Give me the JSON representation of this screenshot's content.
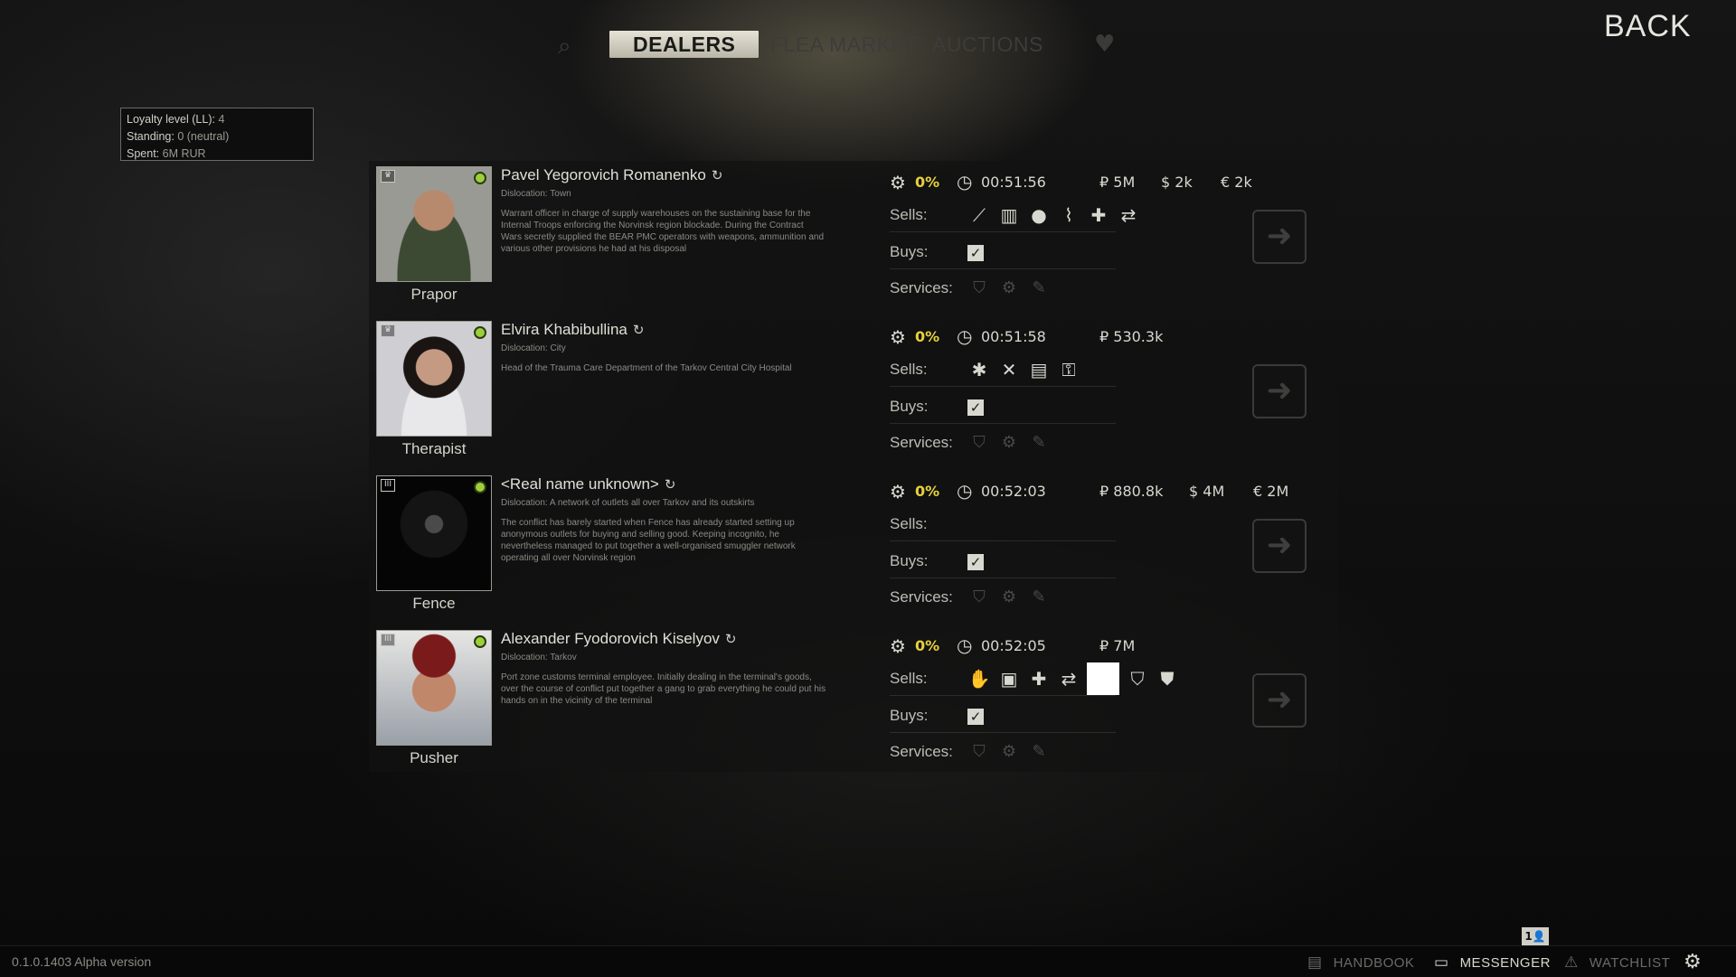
{
  "nav": {
    "tabs": [
      {
        "label": "DEALERS",
        "active": true
      },
      {
        "label": "FLEA MARKET",
        "active": false
      },
      {
        "label": "AUCTIONS",
        "active": false
      }
    ],
    "search_icon": "search-icon",
    "favorites_icon": "heart-icon",
    "back_label": "BACK"
  },
  "tooltip": {
    "loyalty_label": "Loyalty level (LL):",
    "loyalty_value": "4",
    "standing_label": "Standing:",
    "standing_value": "0 (neutral)",
    "spent_label": "Spent:",
    "spent_value": "6M RUR"
  },
  "labels": {
    "sells": "Sells:",
    "buys": "Buys:",
    "services": "Services:"
  },
  "dealers": [
    {
      "nickname": "Prapor",
      "full_name": "Pavel Yegorovich Romanenko",
      "dislocation": "Dislocation: Town",
      "description": "Warrant officer in charge of supply warehouses on the sustaining base for the Internal Troops enforcing the Norvinsk region blockade. During the Contract Wars secretly supplied the BEAR PMC operators with weapons, ammunition and various other provisions he had at his disposal",
      "rank": "♛",
      "discount": "0%",
      "timer": "00:51:56",
      "money": [
        "₽ 5M",
        "$ 2k",
        "€ 2k"
      ],
      "sells": [
        "rifle-icon",
        "magazine-icon",
        "grenade-icon",
        "knife-icon",
        "medkit-icon",
        "trade-icon"
      ],
      "buys_checked": true
    },
    {
      "nickname": "Therapist",
      "full_name": "Elvira Khabibullina",
      "dislocation": "Dislocation: City",
      "description": "Head of the Trauma Care Department of the Tarkov Central City Hospital",
      "rank": "♛",
      "discount": "0%",
      "timer": "00:51:58",
      "money": [
        "₽ 530.3k"
      ],
      "sells": [
        "meds-icon",
        "food-icon",
        "info-icon",
        "key-icon"
      ],
      "buys_checked": true
    },
    {
      "nickname": "Fence",
      "full_name": "<Real name unknown>",
      "dislocation": "Dislocation: A network of outlets all over Tarkov and its outskirts",
      "description": "The conflict has barely started when Fence has already started setting up anonymous outlets for buying and selling good. Keeping incognito, he nevertheless managed to put together a well-organised smuggler network operating all over Norvinsk region",
      "rank": "III",
      "discount": "0%",
      "timer": "00:52:03",
      "money": [
        "₽ 880.8k",
        "$ 4M",
        "€ 2M"
      ],
      "sells": [],
      "buys_checked": true
    },
    {
      "nickname": "Pusher",
      "full_name": "Alexander Fyodorovich Kiselyov",
      "dislocation": "Dislocation: Tarkov",
      "description": "Port zone customs terminal employee. Initially dealing in the terminal's goods, over the course of conflict put together a gang to grab everything he could put his hands on in the vicinity of the terminal",
      "rank": "III",
      "discount": "0%",
      "timer": "00:52:05",
      "money": [
        "₽ 7M"
      ],
      "sells": [
        "gloves-icon",
        "case-icon",
        "medkit-icon",
        "trade-icon",
        "blank-slot",
        "armor-icon",
        "vest-icon"
      ],
      "buys_checked": true
    }
  ],
  "bottom": {
    "version": "0.1.0.1403 Alpha version",
    "handbook": "HANDBOOK",
    "messenger": "MESSENGER",
    "watchlist": "WATCHLIST",
    "friends_badge": "1"
  }
}
